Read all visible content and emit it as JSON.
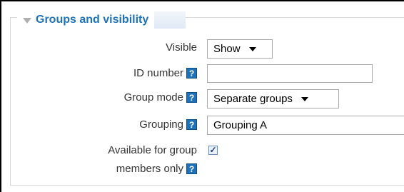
{
  "section": {
    "title": "Groups and visibility"
  },
  "fields": {
    "visible": {
      "label": "Visible",
      "value": "Show"
    },
    "id_number": {
      "label": "ID number",
      "help": "?",
      "value": ""
    },
    "group_mode": {
      "label": "Group mode",
      "help": "?",
      "value": "Separate groups"
    },
    "grouping": {
      "label": "Grouping",
      "help": "?",
      "value": "Grouping A"
    },
    "available": {
      "label_line1": "Available for group",
      "label_line2": "members only",
      "help": "?",
      "checked": "✓"
    }
  }
}
